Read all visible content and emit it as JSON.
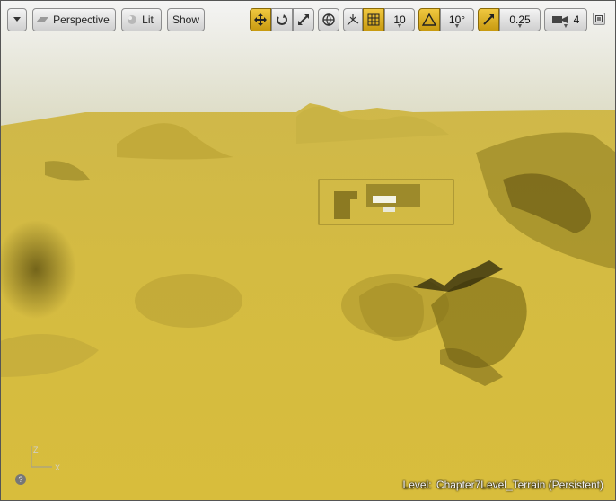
{
  "toolbar": {
    "menu_icon": "chevron-down-icon",
    "view_mode": "Perspective",
    "lighting": "Lit",
    "show": "Show",
    "grid_snap_value": "10",
    "rotation_snap_value": "10°",
    "scale_snap_value": "0.25",
    "camera_speed_value": "4",
    "active_color": "#e0b01e"
  },
  "axes": {
    "z": "Z",
    "x": "X"
  },
  "status": {
    "level_label": "Level:",
    "level_name": "Chapter7Level_Terrain (Persistent)"
  },
  "help_glyph": "?"
}
